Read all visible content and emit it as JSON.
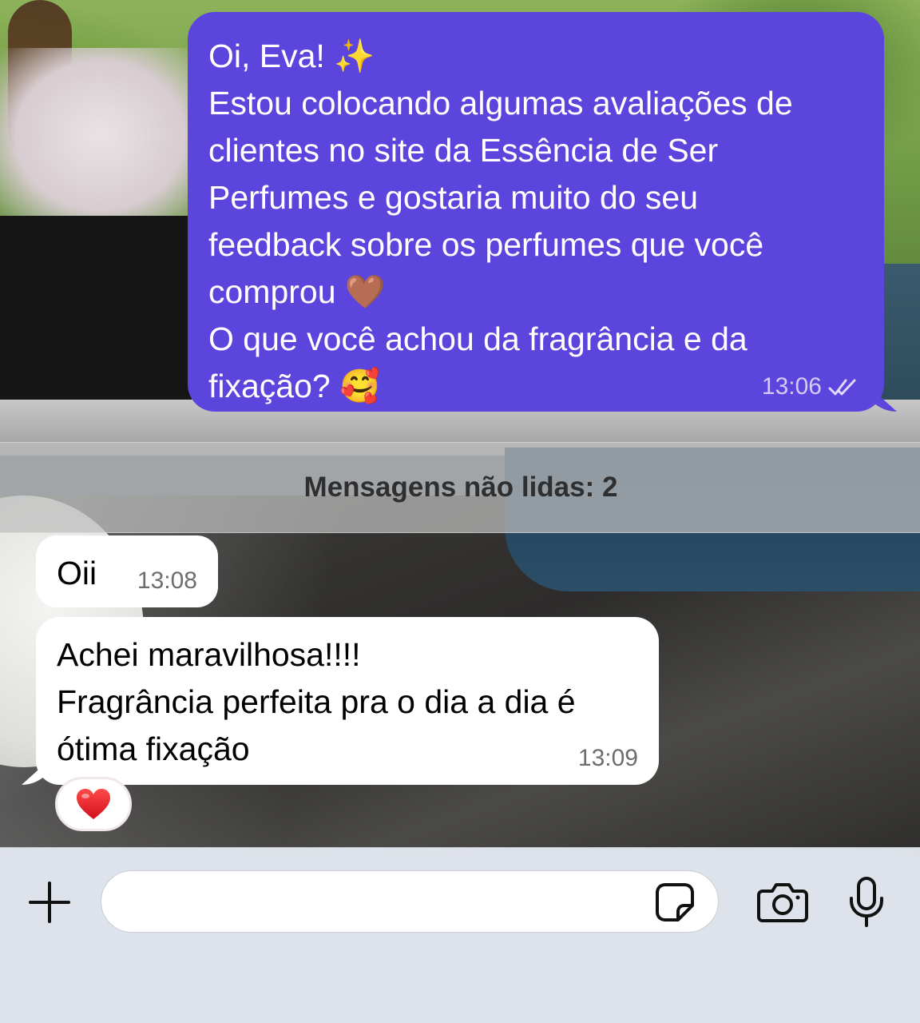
{
  "conversation": {
    "outgoing": {
      "lines": [
        "Oi, Eva! ✨",
        "Estou colocando algumas avaliações de",
        "clientes no site da Essência de Ser",
        "Perfumes e gostaria muito do seu",
        "feedback sobre os perfumes que você",
        "comprou 🤎",
        "O que você achou da fragrância e da",
        "fixação? 🥰"
      ],
      "time": "13:06",
      "status_icon": "double-check-icon",
      "bubble_color": "#5b45dc"
    },
    "unread_label": "Mensagens não lidas: 2",
    "incoming": [
      {
        "lines": [
          "Oii"
        ],
        "time": "13:08"
      },
      {
        "lines": [
          "Achei maravilhosa!!!!",
          "Fragrância perfeita pra o dia a dia é",
          "ótima fixação"
        ],
        "time": "13:09",
        "reaction": "❤️"
      }
    ]
  },
  "composer": {
    "message_value": "",
    "icons": [
      "plus-icon",
      "sticker-icon",
      "camera-icon",
      "microphone-icon"
    ]
  }
}
